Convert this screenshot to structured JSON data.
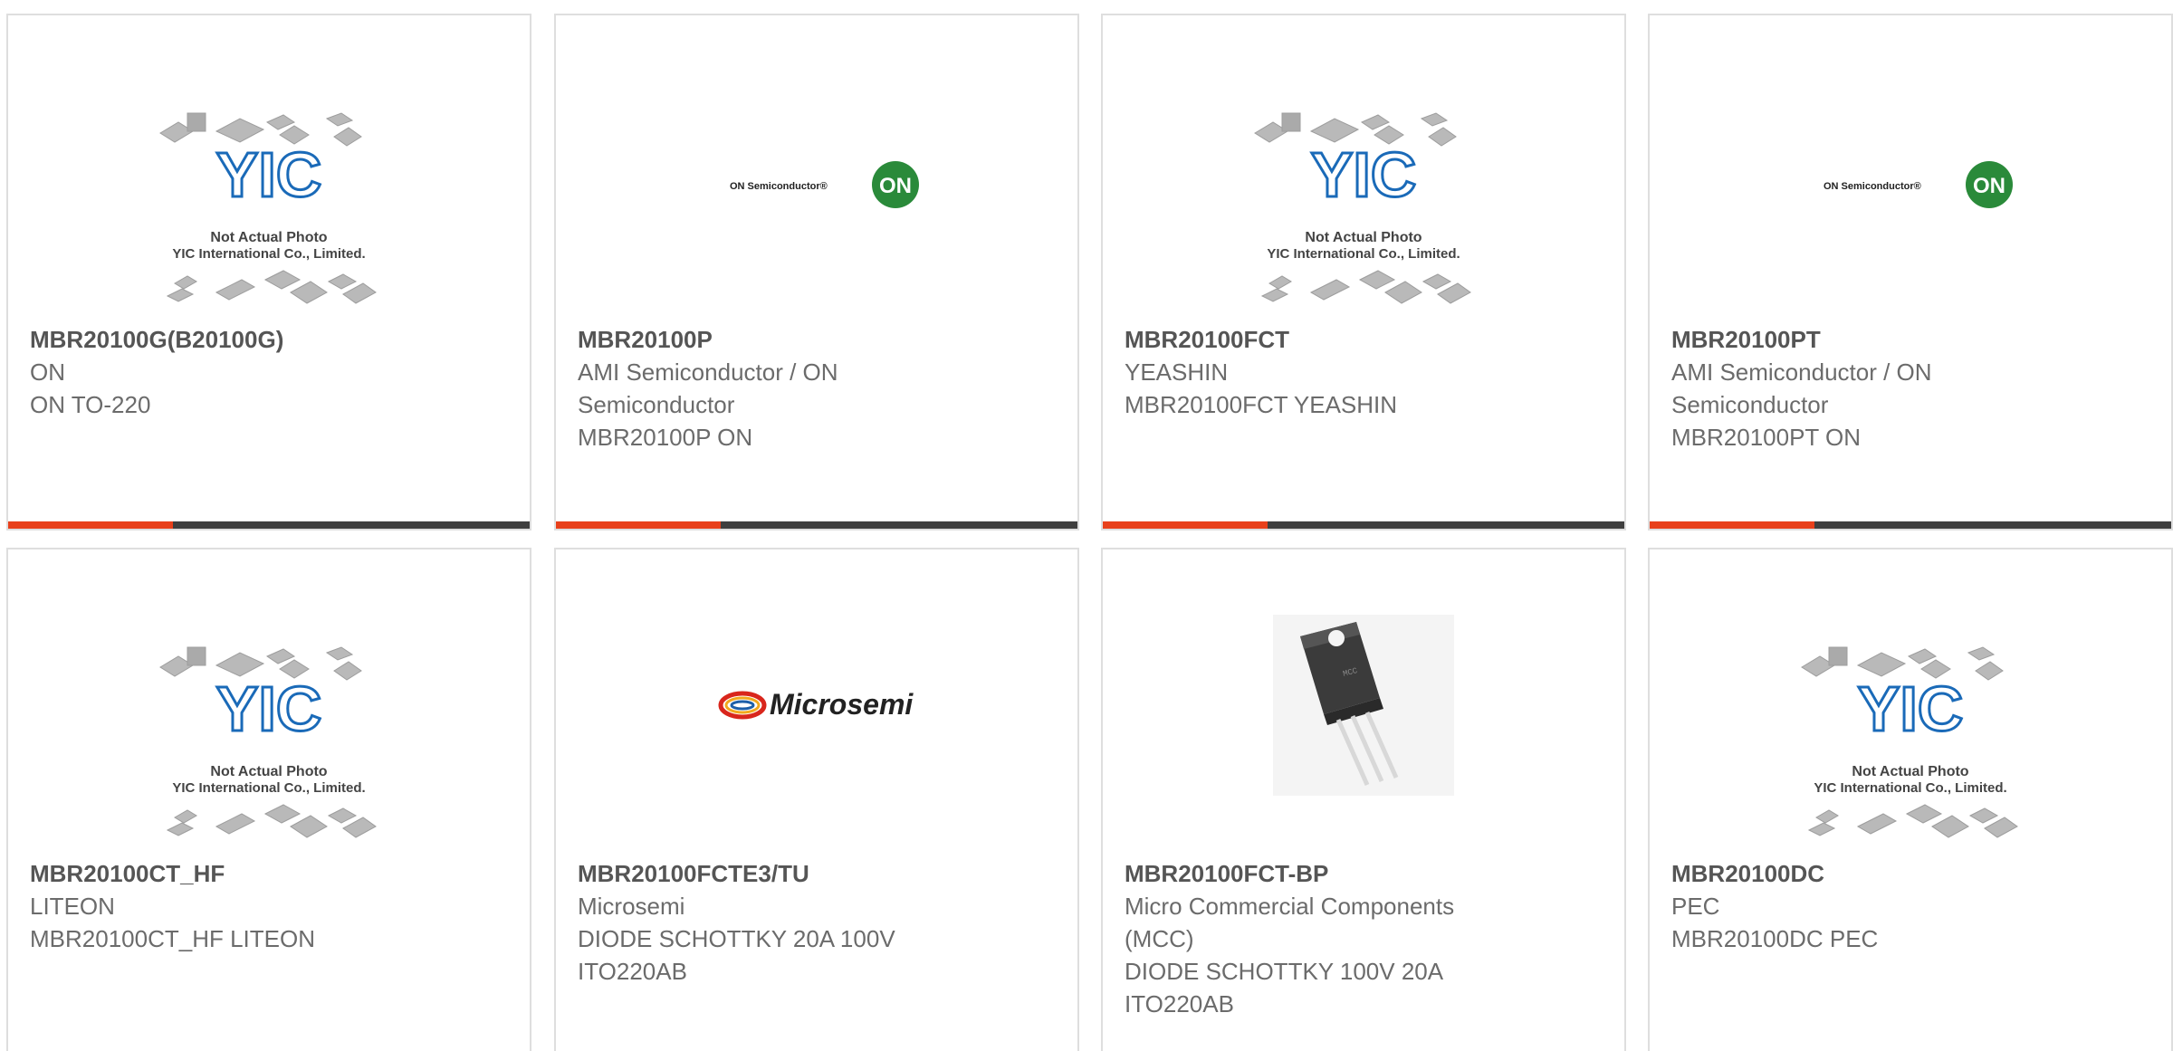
{
  "colors": {
    "accent": "#e8401b",
    "bar_dark": "#3f3f3f",
    "text_dark": "#555555",
    "text_gray": "#6b6b6b",
    "card_border": "#dedede",
    "yic_blue": "#1a6ab8",
    "on_green": "#2a8a3a",
    "microsemi_red": "#d9261c",
    "microsemi_blue": "#1d5fa8"
  },
  "placeholder": {
    "line1": "Not Actual Photo",
    "line2": "YIC International Co., Limited.",
    "logo": "YIC"
  },
  "logos": {
    "on_text": "ON Semiconductor®",
    "on_badge": "ON",
    "microsemi_text": "Microsemi"
  },
  "cards": [
    {
      "image": "yic-placeholder",
      "part_number": "MBR20100G(B20100G)",
      "manufacturer": "ON",
      "desc1": "ON TO-220",
      "desc2": ""
    },
    {
      "image": "on-semiconductor-logo",
      "part_number": "MBR20100P",
      "manufacturer": "AMI Semiconductor / ON Semiconductor",
      "desc1": "MBR20100P ON",
      "desc2": ""
    },
    {
      "image": "yic-placeholder",
      "part_number": "MBR20100FCT",
      "manufacturer": "YEASHIN",
      "desc1": "MBR20100FCT YEASHIN",
      "desc2": ""
    },
    {
      "image": "on-semiconductor-logo",
      "part_number": "MBR20100PT",
      "manufacturer": "AMI Semiconductor / ON Semiconductor",
      "desc1": "MBR20100PT ON",
      "desc2": ""
    },
    {
      "image": "yic-placeholder",
      "part_number": "MBR20100CT_HF",
      "manufacturer": "LITEON",
      "desc1": "MBR20100CT_HF LITEON",
      "desc2": ""
    },
    {
      "image": "microsemi-logo",
      "part_number": "MBR20100FCTE3/TU",
      "manufacturer": "Microsemi",
      "desc1": "DIODE SCHOTTKY 20A 100V ITO220AB",
      "desc2": ""
    },
    {
      "image": "to220-component-photo",
      "part_number": "MBR20100FCT-BP",
      "manufacturer": "Micro Commercial Components (MCC)",
      "desc1": "DIODE SCHOTTKY 100V 20A ITO220AB",
      "desc2": ""
    },
    {
      "image": "yic-placeholder",
      "part_number": "MBR20100DC",
      "manufacturer": "PEC",
      "desc1": "MBR20100DC PEC",
      "desc2": ""
    }
  ]
}
